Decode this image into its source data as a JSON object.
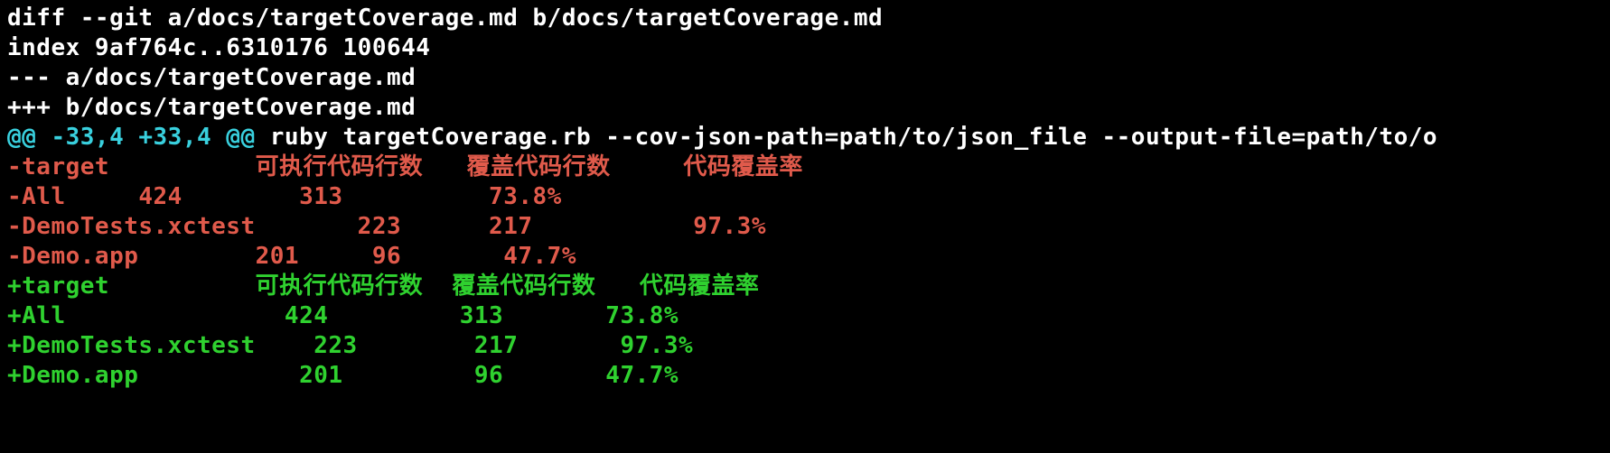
{
  "header": {
    "cmd": "diff --git a/docs/targetCoverage.md b/docs/targetCoverage.md",
    "index": "index 9af764c..6310176 100644",
    "minus": "--- a/docs/targetCoverage.md",
    "plus": "+++ b/docs/targetCoverage.md"
  },
  "hunk": {
    "range": "@@ -33,4 +33,4 @@",
    "context": " ruby targetCoverage.rb --cov-json-path=path/to/json_file --output-file=path/to/o"
  },
  "removed": [
    "-target          可执行代码行数   覆盖代码行数     代码覆盖率",
    "-All     424        313          73.8%",
    "-DemoTests.xctest       223      217           97.3%",
    "-Demo.app        201     96       47.7%"
  ],
  "added": [
    "+target          可执行代码行数  覆盖代码行数   代码覆盖率",
    "+All               424         313       73.8%",
    "+DemoTests.xctest    223        217       97.3%",
    "+Demo.app           201         96       47.7%"
  ],
  "chart_data": {
    "type": "table",
    "title": "targetCoverage.md diff (removed vs added rows represent same data, re-aligned)",
    "columns": [
      "target",
      "可执行代码行数",
      "覆盖代码行数",
      "代码覆盖率"
    ],
    "rows": [
      {
        "target": "All",
        "executable_lines": 424,
        "covered_lines": 313,
        "coverage_pct": 73.8
      },
      {
        "target": "DemoTests.xctest",
        "executable_lines": 223,
        "covered_lines": 217,
        "coverage_pct": 97.3
      },
      {
        "target": "Demo.app",
        "executable_lines": 201,
        "covered_lines": 96,
        "coverage_pct": 47.7
      }
    ]
  }
}
